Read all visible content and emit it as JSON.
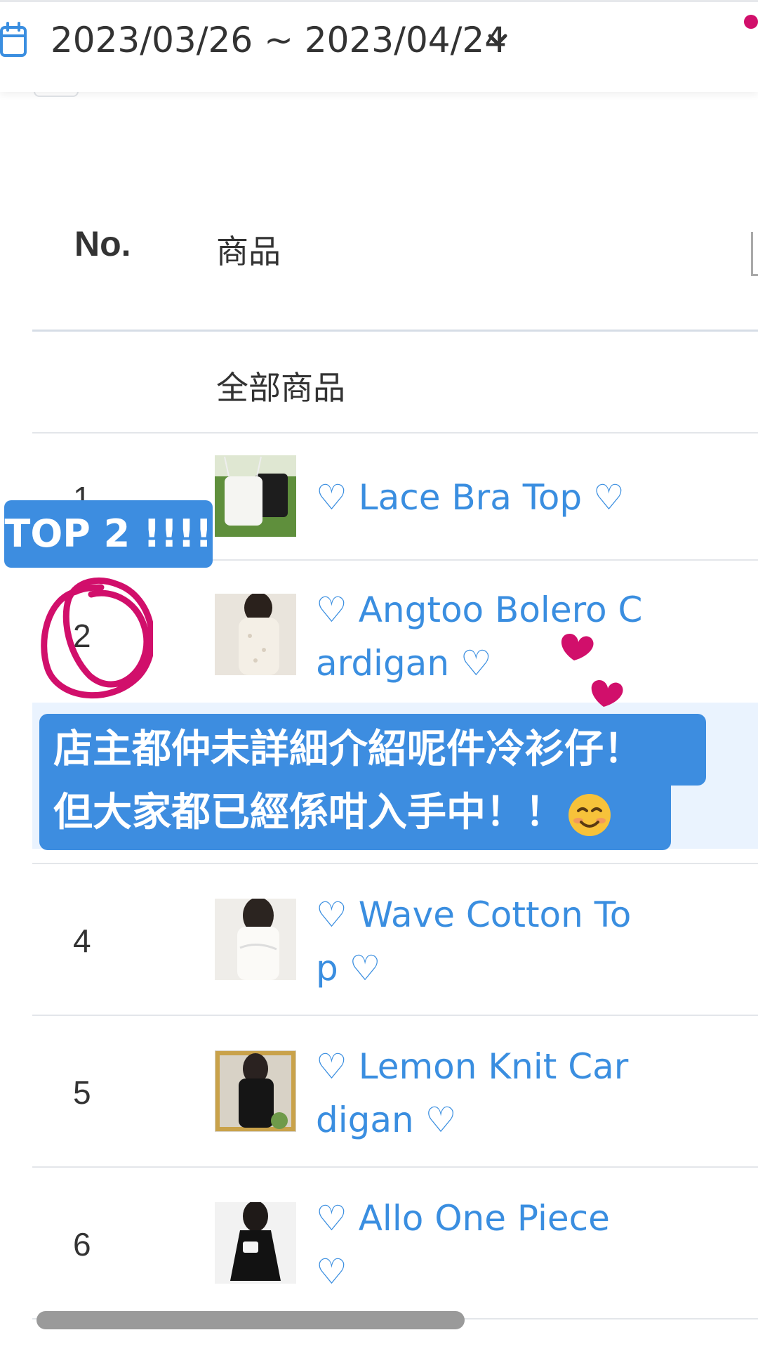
{
  "header": {
    "date_range": "2023/03/26 ~ 2023/04/24",
    "icons": [
      "calendar-icon",
      "chevron-down-icon"
    ],
    "accent_color": "#3a8ee0",
    "notification_dot_color": "#d10f6b"
  },
  "table": {
    "columns": [
      "No.",
      "商品"
    ],
    "all_products_label": "全部商品",
    "rows": [
      {
        "no": "1",
        "name": "♡ Lace Bra Top ♡"
      },
      {
        "no": "2",
        "name": "♡ Angtoo Bolero Cardigan ♡"
      },
      {
        "no": "4",
        "name": "♡ Wave Cotton Top ♡"
      },
      {
        "no": "5",
        "name": "♡ Lemon Knit Cardigan ♡"
      },
      {
        "no": "6",
        "name": "♡ Allo One Piece ♡"
      }
    ]
  },
  "annotations": {
    "badge": "TOP 2 !!!!",
    "comment_line1": "店主都仲未詳細介紹呢件冷衫仔！",
    "comment_line2": "但大家都已經係咁入手中！！",
    "sticker_color": "#3d8de0",
    "ink_color": "#d10f6b"
  }
}
